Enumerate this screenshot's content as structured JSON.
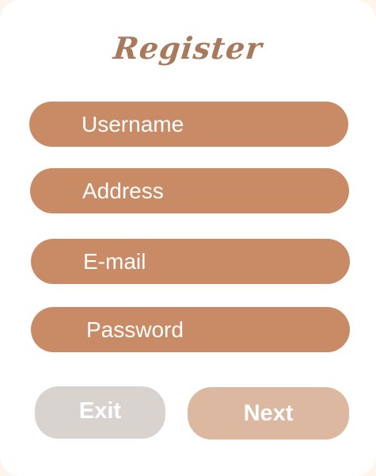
{
  "form": {
    "title": "Register",
    "fields": [
      {
        "label": "Username"
      },
      {
        "label": "Address"
      },
      {
        "label": "E-mail"
      },
      {
        "label": "Password"
      }
    ]
  },
  "actions": {
    "exit_label": "Exit",
    "next_label": "Next"
  },
  "colors": {
    "field_bg": "#c98b65",
    "title": "#a9795b",
    "exit_bg": "#d9d3cf",
    "next_bg": "#dcb8a0",
    "card_bg": "#ffffff",
    "page_bg": "#fdf4ec"
  }
}
